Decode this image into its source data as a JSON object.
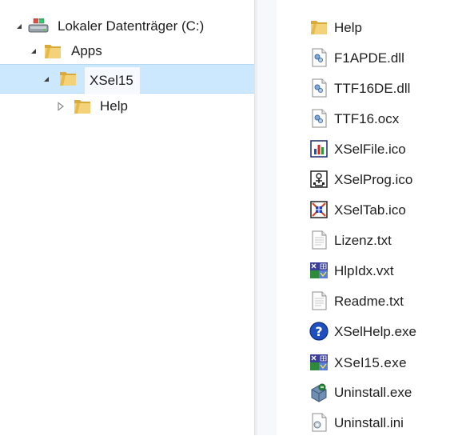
{
  "tree": {
    "drive_label": "Lokaler Datenträger (C:)",
    "apps_label": "Apps",
    "xsel_label": "XSel15",
    "help_label": "Help"
  },
  "files": [
    {
      "name": "Help",
      "icon": "folder-icon"
    },
    {
      "name": "F1APDE.dll",
      "icon": "dll-icon"
    },
    {
      "name": "TTF16DE.dll",
      "icon": "dll-icon"
    },
    {
      "name": "TTF16.ocx",
      "icon": "ocx-icon"
    },
    {
      "name": "XSelFile.ico",
      "icon": "chart-ico-icon"
    },
    {
      "name": "XSelProg.ico",
      "icon": "prog-ico-icon"
    },
    {
      "name": "XSelTab.ico",
      "icon": "tab-ico-icon"
    },
    {
      "name": "Lizenz.txt",
      "icon": "text-file-icon"
    },
    {
      "name": "HlpIdx.vxt",
      "icon": "xsel-app-icon"
    },
    {
      "name": "Readme.txt",
      "icon": "text-file-icon"
    },
    {
      "name": "XSelHelp.exe",
      "icon": "help-exe-icon"
    },
    {
      "name": "XSel15.exe",
      "icon": "xsel-app-icon"
    },
    {
      "name": "Uninstall.exe",
      "icon": "installer-icon"
    },
    {
      "name": "Uninstall.ini",
      "icon": "ini-file-icon"
    }
  ],
  "colors": {
    "selection": "#cce8ff",
    "folder": "#e8c35a"
  }
}
